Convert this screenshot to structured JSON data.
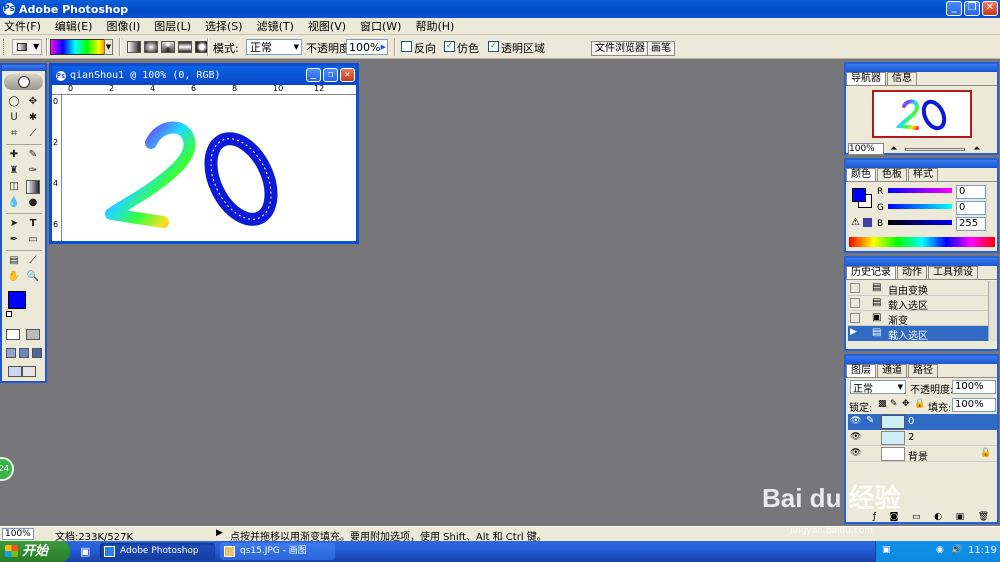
{
  "app": {
    "title": "Adobe Photoshop",
    "logo_letter": "Ps"
  },
  "window_buttons": {
    "minimize": "_",
    "restore": "❐",
    "close": "✕"
  },
  "menu": [
    "文件(F)",
    "编辑(E)",
    "图像(I)",
    "图层(L)",
    "选择(S)",
    "滤镜(T)",
    "视图(V)",
    "窗口(W)",
    "帮助(H)"
  ],
  "options": {
    "mode_label": "模式:",
    "mode_value": "正常",
    "opacity_label": "不透明度:",
    "opacity_value": "100%",
    "reverse_label": "反向",
    "dither_label": "仿色",
    "transparency_label": "透明区域",
    "file_browser_tab": "文件浏览器",
    "brushes_tab": "画笔"
  },
  "document": {
    "title": "qianShou1 @ 100% (0, RGB)",
    "ruler_marks": [
      "0",
      "2",
      "4",
      "6",
      "8",
      "10",
      "12"
    ],
    "artwork_text": "20",
    "number_two_color": "#ff3ec8",
    "number_zero_color": "#0b1ad6"
  },
  "navigator": {
    "tabs": [
      "导航器",
      "信息"
    ],
    "zoom": "100%"
  },
  "color_panel": {
    "tabs": [
      "颜色",
      "色板",
      "样式"
    ],
    "r_label": "R",
    "r_value": "0",
    "g_label": "G",
    "g_value": "0",
    "b_label": "B",
    "b_value": "255",
    "foreground": "#0000ff",
    "background": "#ffffff"
  },
  "history_panel": {
    "tabs": [
      "历史记录",
      "动作",
      "工具预设"
    ],
    "items": [
      "自由变换",
      "载入选区",
      "渐变",
      "载入选区"
    ],
    "selected_index": 3
  },
  "layers_panel": {
    "tabs": [
      "图层",
      "通道",
      "路径"
    ],
    "blend_mode": "正常",
    "opacity_label": "不透明度:",
    "opacity_value": "100%",
    "lock_label": "锁定:",
    "fill_label": "填充:",
    "fill_value": "100%",
    "layers": [
      "0",
      "2",
      "背景"
    ],
    "selected_index": 0
  },
  "statusbar": {
    "zoom": "100%",
    "doc_size": "文档:233K/527K",
    "hint": "点按并拖移以用渐变填充。要用附加选项，使用 Shift、Alt 和 Ctrl 键。"
  },
  "taskbar": {
    "start": "开始",
    "items": [
      "Adobe Photoshop",
      "qs15.JPG - 画图"
    ],
    "clock": "11:19"
  },
  "watermark": {
    "brand": "Bai du 经验",
    "url": "jingyan.baidu.com"
  },
  "badge": "24"
}
